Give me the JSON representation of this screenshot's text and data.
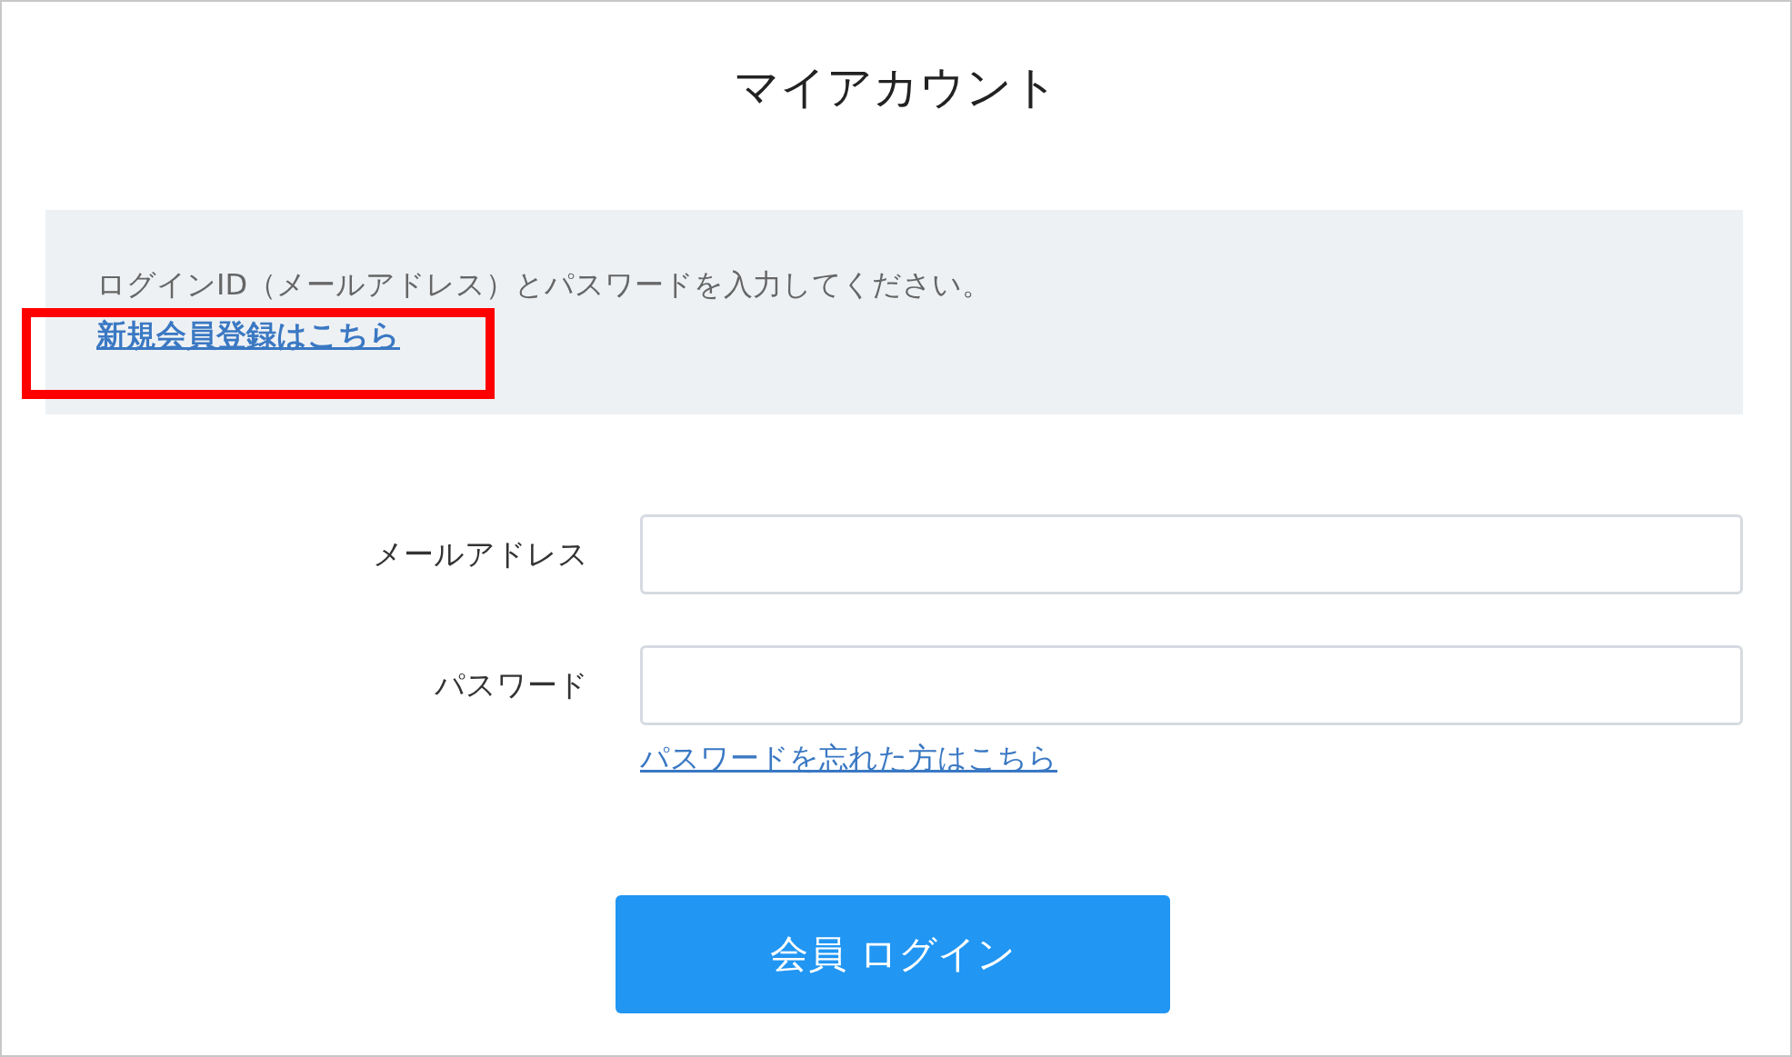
{
  "title": "マイアカウント",
  "notice": {
    "text": "ログインID（メールアドレス）とパスワードを入力してください。",
    "signup_link": {
      "label": "新規会員登録はこちら",
      "highlighted": true
    }
  },
  "fields": [
    {
      "label": "メールアドレス"
    },
    {
      "label": "パスワード"
    }
  ],
  "forgot_link": "パスワードを忘れた方はこちら",
  "login_button": "会員 ログイン"
}
